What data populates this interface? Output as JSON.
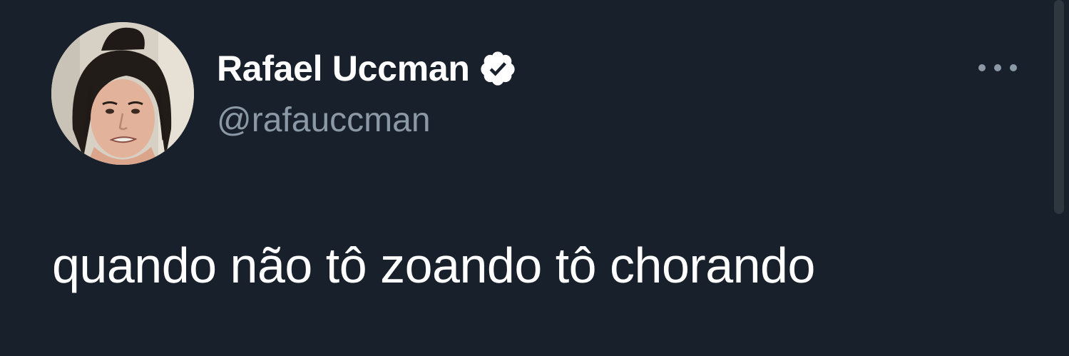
{
  "tweet": {
    "author": {
      "display_name": "Rafael Uccman",
      "handle": "@rafauccman",
      "verified": true,
      "avatar": "profile-photo"
    },
    "text": "quando não tô zoando tô chorando",
    "menu_icon": "more-horizontal-icon"
  },
  "colors": {
    "background": "#18202b",
    "primary_text": "#ffffff",
    "secondary_text": "#8b98a5"
  }
}
